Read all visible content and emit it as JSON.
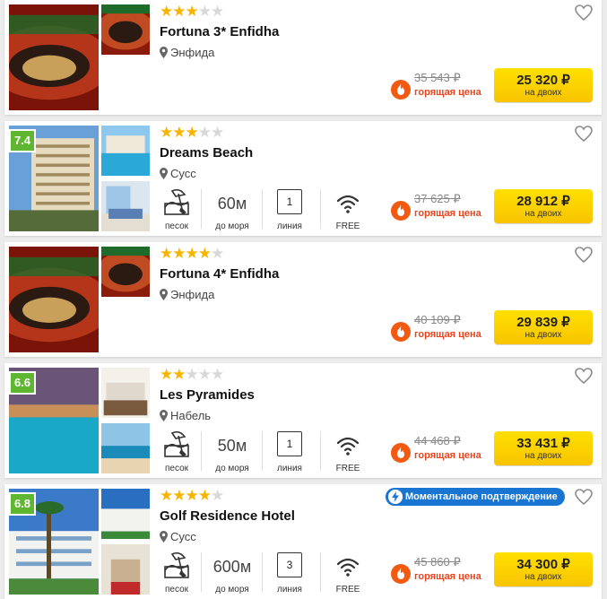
{
  "hotels": [
    {
      "name": "Fortuna 3* Enfidha",
      "stars": 3,
      "rating": "",
      "location": "Энфида",
      "old_price": "35 543 ₽",
      "hot_label": "горящая цена",
      "price": "25 320 ₽",
      "price_sub": "на двоих",
      "has_features": false,
      "image_theme": "roulette"
    },
    {
      "name": "Dreams Beach",
      "stars": 3,
      "rating": "7.4",
      "location": "Сусс",
      "old_price": "37 625 ₽",
      "hot_label": "горящая цена",
      "price": "28 912 ₽",
      "price_sub": "на двоих",
      "has_features": true,
      "features": {
        "beach": "песок",
        "distance": "60м",
        "distance_label": "до моря",
        "line": "1",
        "line_label": "линия",
        "wifi": "FREE"
      },
      "image_theme": "building"
    },
    {
      "name": "Fortuna 4* Enfidha",
      "stars": 4,
      "rating": "",
      "location": "Энфида",
      "old_price": "40 109 ₽",
      "hot_label": "горящая цена",
      "price": "29 839 ₽",
      "price_sub": "на двоих",
      "has_features": false,
      "image_theme": "roulette"
    },
    {
      "name": "Les Pyramides",
      "stars": 2,
      "rating": "6.6",
      "location": "Набель",
      "old_price": "44 468 ₽",
      "hot_label": "горящая цена",
      "price": "33 431 ₽",
      "price_sub": "на двоих",
      "has_features": true,
      "features": {
        "beach": "песок",
        "distance": "50м",
        "distance_label": "до моря",
        "line": "1",
        "line_label": "линия",
        "wifi": "FREE"
      },
      "image_theme": "pool-night"
    },
    {
      "name": "Golf Residence Hotel",
      "stars": 4,
      "rating": "6.8",
      "location": "Сусс",
      "old_price": "45 860 ₽",
      "hot_label": "горящая цена",
      "price": "34 300 ₽",
      "price_sub": "на двоих",
      "has_features": true,
      "instant_badge": "Моментальное подтверждение",
      "features": {
        "beach": "песок",
        "distance": "600м",
        "distance_label": "до моря",
        "line": "3",
        "line_label": "линия",
        "wifi": "FREE"
      },
      "image_theme": "resort"
    }
  ],
  "colors": {
    "accent_yellow": "#f8c400",
    "rating_green": "#5fb631",
    "hot_red": "#e8451e",
    "badge_blue": "#1975d2",
    "star": "#f7b500"
  }
}
